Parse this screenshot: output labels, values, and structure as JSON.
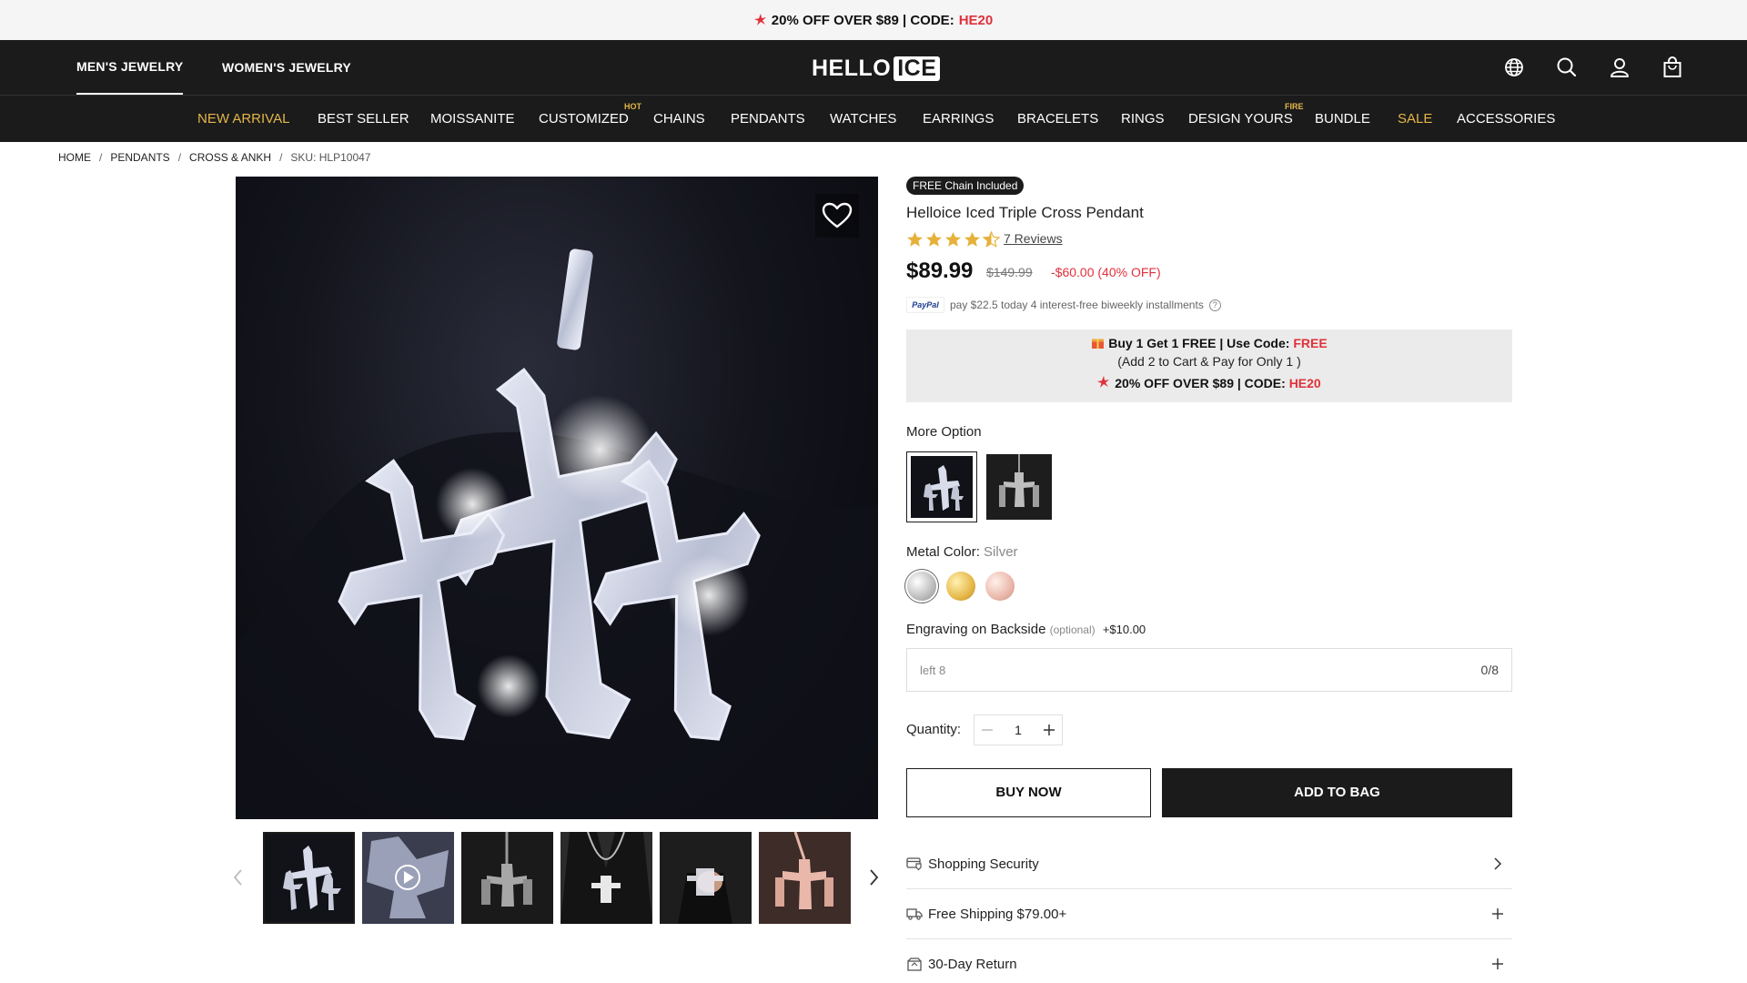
{
  "announcement": {
    "text": "20% OFF OVER $89 | CODE: ",
    "code": "HE20"
  },
  "header": {
    "tabs": [
      "MEN'S JEWELRY",
      "WOMEN'S JEWELRY"
    ],
    "logo_left": "HELLO",
    "logo_right": "ICE"
  },
  "nav": {
    "items": [
      "NEW ARRIVAL",
      "BEST SELLER",
      "MOISSANITE",
      "CUSTOMIZED",
      "CHAINS",
      "PENDANTS",
      "WATCHES",
      "EARRINGS",
      "BRACELETS",
      "RINGS",
      "DESIGN YOURS",
      "BUNDLE",
      "SALE",
      "ACCESSORIES"
    ],
    "tags": {
      "customized": "HOT",
      "design_yours": "FIRE"
    },
    "highlight_color": "#e4b64a"
  },
  "breadcrumb": [
    "HOME",
    "PENDANTS",
    "CROSS & ANKH",
    "SKU: HLP10047"
  ],
  "product": {
    "badge": "FREE Chain Included",
    "title": "Helloice Iced Triple Cross Pendant",
    "rating": 4.5,
    "reviews": "7 Reviews",
    "price": "$89.99",
    "old_price": "$149.99",
    "savings": "-$60.00 (40% OFF)",
    "paypal": "pay  $22.5  today 4 interest-free biweekly installments"
  },
  "promo": {
    "line1_prefix": "Buy 1 Get 1 FREE | Use Code: ",
    "line1_code": "FREE",
    "line2": "(Add 2 to Cart & Pay for Only 1 )",
    "line3_prefix": "20% OFF OVER $89 | CODE: ",
    "line3_code": "HE20"
  },
  "options": {
    "more_option_label": "More Option",
    "metal_label": "Metal Color: ",
    "metal_value": "Silver",
    "swatch_colors": [
      "#d9d9d9",
      "#e6b84a",
      "#e9b8aa"
    ],
    "engraving_label": "Engraving on Backside",
    "engraving_optional": "(optional)",
    "engraving_price": "+$10.00",
    "engraving_placeholder": "left 8",
    "engraving_count": "0/8",
    "quantity_label": "Quantity:",
    "quantity_value": "1"
  },
  "buttons": {
    "buy_now": "BUY NOW",
    "add_to_bag": "ADD TO BAG"
  },
  "accordion": [
    "Shopping Security",
    "Free Shipping $79.00+",
    "30-Day Return"
  ]
}
